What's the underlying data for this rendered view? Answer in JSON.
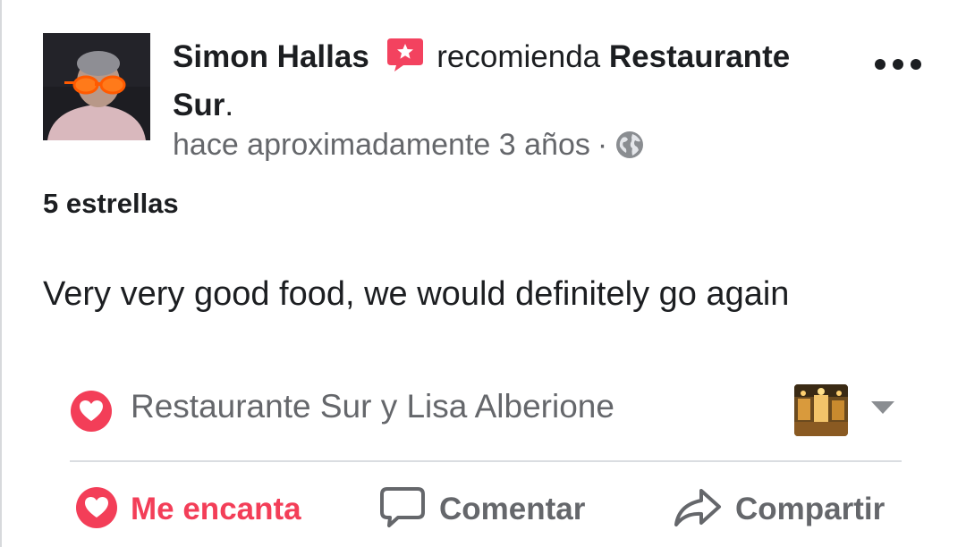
{
  "post": {
    "author": "Simon Hallas",
    "verb": "recomienda",
    "page": "Restaurante Sur",
    "page_suffix": ".",
    "meta_dot": "·"
  },
  "meta": {
    "time": "hace aproximadamente 3 años",
    "privacy_icon": "globe-icon"
  },
  "rating": "5 estrellas",
  "review_text": "Very very good food, we would definitely go again",
  "reactions": {
    "names": "Restaurante Sur y Lisa Alberione",
    "icon": "heart-icon"
  },
  "actions": {
    "love": "Me encanta",
    "comment": "Comentar",
    "share": "Compartir"
  },
  "colors": {
    "love_red": "#f33e58",
    "secondary_text": "#65676b",
    "primary_text": "#1c1e21"
  }
}
